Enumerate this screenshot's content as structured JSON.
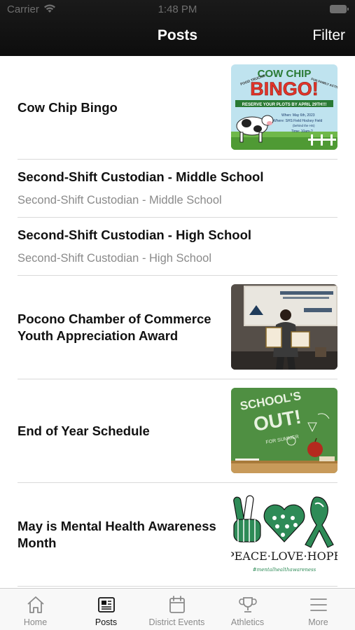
{
  "status_bar": {
    "carrier": "Carrier",
    "time": "1:48 PM"
  },
  "nav": {
    "title": "Posts",
    "filter_label": "Filter"
  },
  "posts": [
    {
      "title": "Cow Chip Bingo",
      "image": "cow-chip-bingo-flyer",
      "flyer": {
        "heading_top": "COW CHIP",
        "heading_main": "BINGO!",
        "left_badge": "FOOD TRUCKS!",
        "right_badge": "FUN FAMILY ACTIVITIES!",
        "banner": "RESERVE YOUR PLOTS BY APRIL 29TH!!!",
        "when": "When: May 6th, 2023",
        "where": "Where: SHS Field Hockey Field",
        "where2": "(behind the HS)",
        "time": "Time: 10am-?"
      }
    },
    {
      "title": "Second-Shift Custodian - Middle School",
      "subtitle": "Second-Shift Custodian - Middle School"
    },
    {
      "title": "Second-Shift Custodian - High School",
      "subtitle": "Second-Shift Custodian - High School"
    },
    {
      "title": "Pocono Chamber of Commerce Youth Appreciation Award",
      "image": "award-photo"
    },
    {
      "title": "End of Year Schedule",
      "image": "schools-out-chalkboard",
      "chalk": {
        "line1": "SCHOOL'S",
        "line2": "OUT!",
        "line3": "FOR SUMMER"
      }
    },
    {
      "title": "May is Mental Health Awareness Month",
      "image": "peace-love-hope",
      "graphic": {
        "caption": "PEACE·LOVE·HOPE",
        "small": "#mentalhealthawareness"
      }
    }
  ],
  "tabs": [
    {
      "label": "Home",
      "icon": "home-icon",
      "active": false
    },
    {
      "label": "Posts",
      "icon": "newspaper-icon",
      "active": true
    },
    {
      "label": "District Events",
      "icon": "calendar-icon",
      "active": false
    },
    {
      "label": "Athletics",
      "icon": "trophy-icon",
      "active": false
    },
    {
      "label": "More",
      "icon": "menu-icon",
      "active": false
    }
  ],
  "colors": {
    "nav_background": "#111111",
    "accent_green": "#2e8b57",
    "tab_inactive": "#8a8a8a"
  }
}
